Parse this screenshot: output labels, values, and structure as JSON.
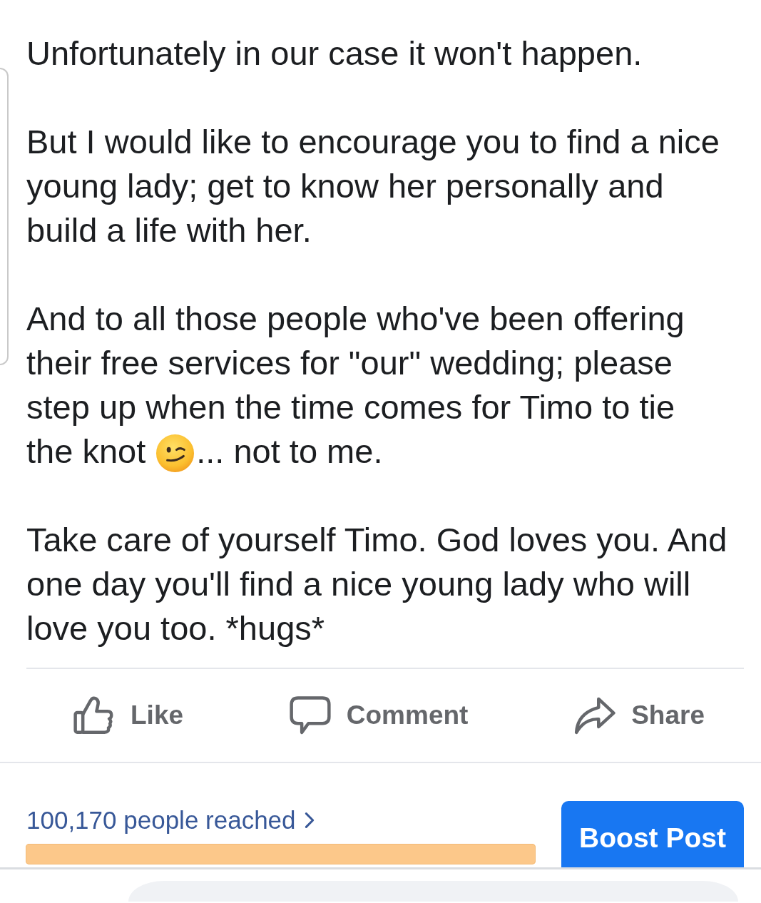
{
  "post": {
    "paragraphs": [
      {
        "lines": [
          "Unfortunately in our case it won't happen."
        ]
      },
      {
        "lines": [
          "But I would like to encourage you to find a nice",
          "young lady; get to know her personally and",
          "build a life with her."
        ]
      },
      {
        "lines": [
          "And to all those people who've been offering",
          "their free services for \"our\" wedding; please",
          "step up when the time comes for Timo to tie"
        ],
        "emoji_line": {
          "before": "the knot",
          "after": "... not to me."
        }
      },
      {
        "lines": [
          "Take care of yourself Timo. God loves you. And",
          "one day you'll find a nice young lady who will",
          "love you too. *hugs*"
        ]
      }
    ]
  },
  "actions": [
    {
      "kind": "like",
      "label": "Like"
    },
    {
      "kind": "comment",
      "label": "Comment"
    },
    {
      "kind": "share",
      "label": "Share"
    }
  ],
  "insights": {
    "reach": "100,170 people reached"
  },
  "boost_button": "Boost Post"
}
